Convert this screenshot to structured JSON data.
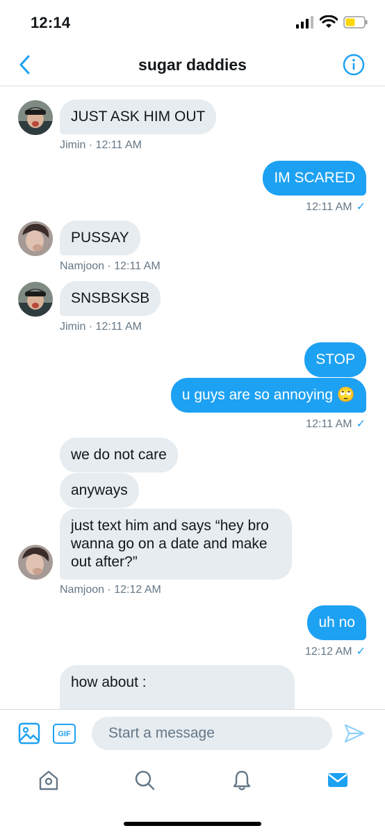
{
  "status_bar": {
    "time": "12:14"
  },
  "header": {
    "title": "sugar daddies"
  },
  "messages": [
    {
      "text": "JUST ASK HIM OUT",
      "sender": "Jimin",
      "time": "12:11 AM",
      "meta": "Jimin · 12:11 AM"
    },
    {
      "text": "IM SCARED",
      "meta": "12:11 AM"
    },
    {
      "text": "PUSSAY",
      "sender": "Namjoon",
      "meta": "Namjoon · 12:11 AM"
    },
    {
      "text": "SNSBSKSB",
      "sender": "Jimin",
      "meta": "Jimin · 12:11 AM"
    },
    {
      "text": "STOP"
    },
    {
      "text": "u guys are so annoying 🙄",
      "meta": "12:11 AM"
    },
    {
      "text": "we do not care"
    },
    {
      "text": "anyways"
    },
    {
      "text_lines": [
        "just text him and says “hey bro",
        "wanna go on a date and make",
        "out after?”"
      ],
      "sender": "Namjoon",
      "meta": "Namjoon · 12:12 AM"
    },
    {
      "text": "uh no",
      "meta": "12:12 AM"
    },
    {
      "text": "how about :"
    }
  ],
  "composer": {
    "placeholder": "Start a message",
    "gif_label": "GIF"
  },
  "colors": {
    "accent": "#1da1f2",
    "incoming_bubble": "#e6ecf0",
    "meta_text": "#657786",
    "battery": "#ffd60a"
  },
  "icons": [
    "back-chevron-icon",
    "info-icon",
    "image-icon",
    "gif-icon",
    "send-icon",
    "home-icon",
    "search-icon",
    "notifications-bell-icon",
    "messages-envelope-icon"
  ]
}
